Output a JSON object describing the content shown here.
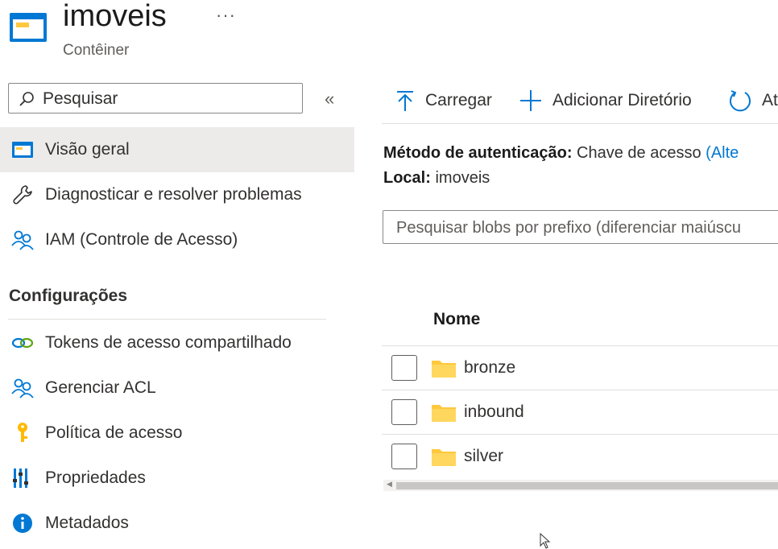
{
  "header": {
    "title": "imoveis",
    "subtitle": "Contêiner",
    "more_label": "···",
    "icon": "container-icon"
  },
  "sidebar": {
    "search_placeholder": "Pesquisar",
    "collapse_label": "«",
    "items": [
      {
        "label": "Visão geral",
        "icon": "overview-icon",
        "active": true
      },
      {
        "label": "Diagnosticar e resolver problemas",
        "icon": "wrench-icon"
      },
      {
        "label": "IAM (Controle de Acesso)",
        "icon": "people-icon"
      }
    ],
    "section_title": "Configurações",
    "settings_items": [
      {
        "label": "Tokens de acesso compartilhado",
        "icon": "link-icon"
      },
      {
        "label": "Gerenciar ACL",
        "icon": "people-icon"
      },
      {
        "label": "Política de acesso",
        "icon": "key-icon"
      },
      {
        "label": "Propriedades",
        "icon": "properties-icon"
      },
      {
        "label": "Metadados",
        "icon": "info-icon"
      }
    ]
  },
  "toolbar": {
    "upload_label": "Carregar",
    "add_directory_label": "Adicionar Diretório",
    "refresh_label": "At"
  },
  "details": {
    "auth_label": "Método de autenticação:",
    "auth_value": "Chave de acesso",
    "auth_link": "(Alte",
    "location_label": "Local:",
    "location_value": "imoveis"
  },
  "blob_search": {
    "placeholder": "Pesquisar blobs por prefixo (diferenciar maiúscu"
  },
  "table": {
    "column_name": "Nome",
    "rows": [
      {
        "name": "bronze"
      },
      {
        "name": "inbound"
      },
      {
        "name": "silver"
      }
    ]
  },
  "colors": {
    "accent": "#0078d4",
    "folder": "#ffc83d",
    "active_nav": "#edebe9"
  }
}
